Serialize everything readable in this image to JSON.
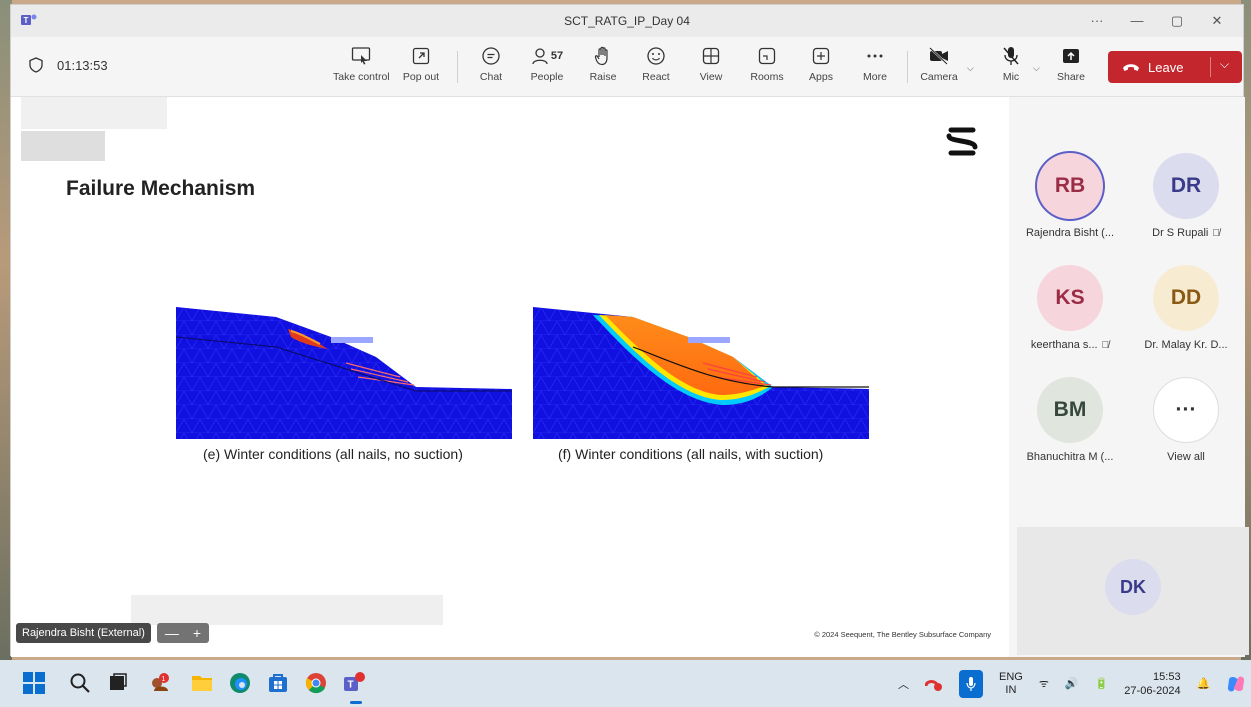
{
  "window": {
    "title": "SCT_RATG_IP_Day 04",
    "controls": [
      "···",
      "—",
      "▢",
      "✕"
    ]
  },
  "toolbar": {
    "timer": "01:13:53",
    "buttons": {
      "take_control": "Take control",
      "pop_out": "Pop out",
      "chat": "Chat",
      "people": "People",
      "people_count": "57",
      "raise": "Raise",
      "react": "React",
      "view": "View",
      "rooms": "Rooms",
      "apps": "Apps",
      "more": "More",
      "camera": "Camera",
      "mic": "Mic",
      "share": "Share"
    },
    "leave": "Leave",
    "leave_color": "#c4262e"
  },
  "slide": {
    "title": "Failure Mechanism",
    "caption_e": "(e) Winter conditions (all nails, no suction)",
    "caption_f": "(f) Winter conditions (all nails, with suction)",
    "copyright": "© 2024 Seequent, The Bentley Subsurface Company"
  },
  "presenter": {
    "name": "Rajendra Bisht (External)",
    "zoom_out": "—",
    "zoom_in": "+"
  },
  "participants": [
    {
      "initials": "RB",
      "name": "Rajendra Bisht (...",
      "bg": "#f6d5dc",
      "fg": "#9b2c46",
      "muted": false,
      "speaking": true
    },
    {
      "initials": "DR",
      "name": "Dr S Rupali",
      "bg": "#dcdcef",
      "fg": "#3a3a8a",
      "muted": true,
      "speaking": false
    },
    {
      "initials": "KS",
      "name": "keerthana s...",
      "bg": "#f6d5dc",
      "fg": "#9b2c46",
      "muted": true,
      "speaking": false
    },
    {
      "initials": "DD",
      "name": "Dr. Malay Kr. D...",
      "bg": "#f7ecd2",
      "fg": "#8a5a14",
      "muted": false,
      "speaking": false
    },
    {
      "initials": "BM",
      "name": "Bhanuchitra M (...",
      "bg": "#e0e5de",
      "fg": "#37483a",
      "muted": false,
      "speaking": false
    },
    {
      "initials": "···",
      "name": "View all",
      "bg": "#ffffff",
      "fg": "#333333",
      "muted": false,
      "speaking": false
    }
  ],
  "bottom_participant": {
    "initials": "DK"
  },
  "taskbar": {
    "lang_top": "ENG",
    "lang_bottom": "IN",
    "time": "15:53",
    "date": "27-06-2024",
    "badge": "1"
  }
}
